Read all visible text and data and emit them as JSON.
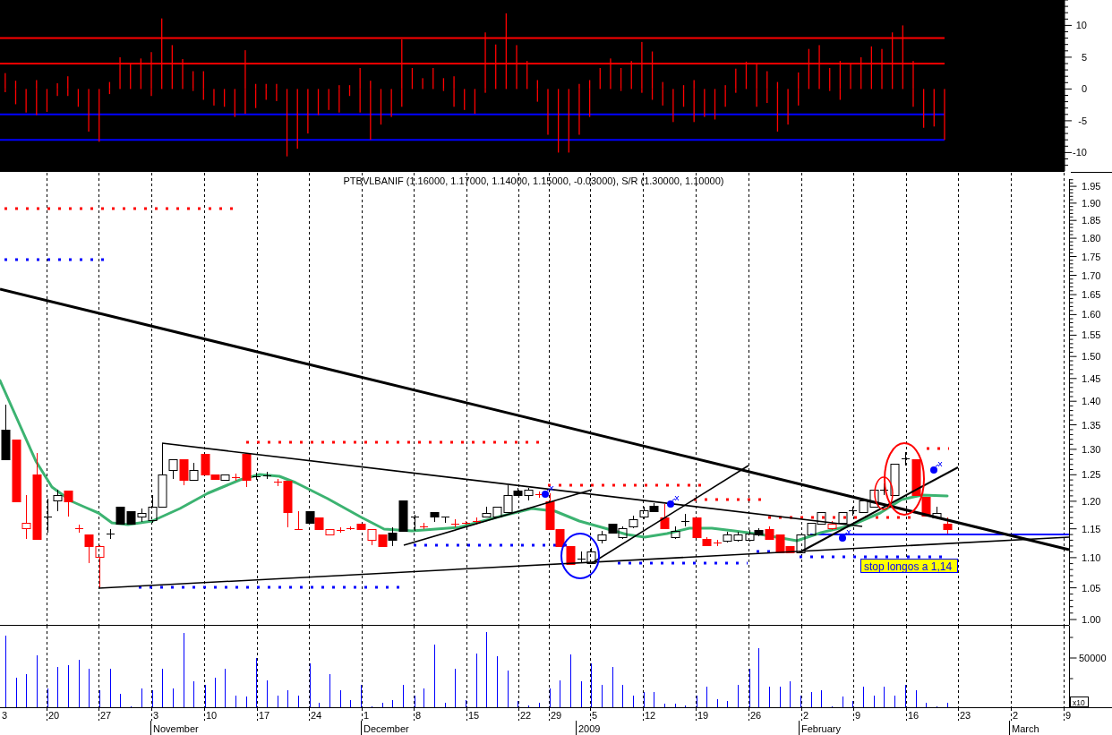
{
  "oscillator": {
    "chart_data": {
      "type": "bar",
      "stacked": true,
      "categories": [
        null,
        null,
        null,
        null,
        null,
        null,
        null,
        null,
        null,
        null,
        null,
        null,
        null,
        null,
        null,
        null,
        null,
        null,
        null,
        null,
        null,
        null,
        null,
        null,
        null,
        null,
        null,
        null,
        null,
        null,
        null,
        null,
        null,
        null,
        null,
        null,
        null,
        null,
        null,
        null,
        null,
        null,
        null,
        null,
        null,
        null,
        null,
        null,
        null,
        null,
        null,
        null,
        null,
        null,
        null,
        null,
        null,
        null,
        null,
        null,
        null,
        null,
        null,
        null,
        null,
        null,
        null,
        null,
        null,
        null,
        null,
        null,
        null,
        null,
        null,
        null,
        null,
        null,
        null,
        null,
        null,
        null,
        null,
        null,
        null,
        null,
        null,
        null,
        null,
        null,
        null,
        null,
        null,
        null,
        null,
        null,
        null,
        null,
        null,
        null,
        null,
        null
      ],
      "ylim": [
        -12.9,
        14
      ],
      "yticks": [
        -10,
        -5,
        0,
        5,
        10
      ],
      "series": [
        {
          "color": "#ff0000",
          "values": [
            2.5,
            1.3,
            0,
            1.4,
            0,
            0.9,
            2,
            0,
            0,
            0,
            1.1,
            5,
            4.1,
            4.8,
            5.8,
            11.1,
            6.9,
            4.7,
            2.8,
            2.8,
            0,
            0,
            0,
            6.1,
            0.8,
            0.8,
            0.8,
            0,
            0,
            0,
            0,
            0,
            0.6,
            0.6,
            3.3,
            1.3,
            0,
            0,
            7.8,
            3.3,
            1.7,
            3.3,
            1.7,
            2,
            0,
            0,
            8.9,
            7,
            11.9,
            6.9,
            4.4,
            1.4,
            0,
            0,
            0,
            0.8,
            1.4,
            3.3,
            4.8,
            3.3,
            4.4,
            7.4,
            5.9,
            1.1,
            0,
            0.6,
            1.4,
            0,
            0,
            0.6,
            3.2,
            4.3,
            4.1,
            2.8,
            1.1,
            0,
            2.6,
            6.3,
            6.9,
            3.3,
            4.4,
            4.1,
            5,
            6.7,
            6.3,
            8.9,
            10,
            4.4,
            0,
            0,
            0,
            null,
            null,
            null,
            null,
            null,
            null,
            null,
            null,
            null,
            null,
            null
          ]
        },
        {
          "color": "#ff0000",
          "values": [
            -0.5,
            -2.4,
            -3.7,
            -4.1,
            -3.6,
            -1.1,
            -1.1,
            -2.8,
            -6.7,
            -8.3,
            -0.8,
            0,
            0,
            0,
            -1.1,
            0,
            0,
            0,
            -0.3,
            -1.7,
            -2.6,
            -2.8,
            -4.4,
            -3.9,
            -3,
            -1.7,
            -1.9,
            -10.6,
            -9.4,
            -7,
            -4.1,
            -3.3,
            -3.7,
            -1.1,
            -3.7,
            -8,
            -5.6,
            -4.4,
            -2.8,
            0,
            0,
            0,
            -0.3,
            -2.8,
            -3.3,
            -3.9,
            -0.6,
            0,
            0,
            0,
            0,
            -2,
            -7.2,
            -10,
            -10,
            -7.2,
            -4.4,
            0,
            0,
            -0.3,
            0,
            -0.6,
            -1.7,
            -2.6,
            -5.2,
            -2.8,
            -5.2,
            -4.4,
            -4.8,
            -2.8,
            -0.6,
            0,
            -2.8,
            -2.2,
            -6.7,
            -5.6,
            -2.6,
            0,
            0,
            -0.3,
            -1.7,
            0,
            0,
            0,
            0,
            0,
            0,
            -2.8,
            -6.1,
            -5.9,
            -8,
            null,
            null,
            null,
            null,
            null,
            null,
            null,
            null,
            null,
            null,
            null
          ]
        }
      ],
      "ref_lines": [
        {
          "axis": "y",
          "value": 8,
          "color": "#ff0000"
        },
        {
          "axis": "y",
          "value": 4,
          "color": "#ff0000"
        },
        {
          "axis": "y",
          "value": -4,
          "color": "#0000ff"
        },
        {
          "axis": "y",
          "value": -8,
          "color": "#0000ff"
        }
      ]
    }
  },
  "price_chart": {
    "title": "PTBVLBANIF (1.16000, 1.17000, 1.14000, 1.15000, -0.03000), S/R (1.30000, 1.10000)",
    "note": "stop longos a 1,14",
    "axis_labels": [
      "1.95",
      "1.90",
      "1.85",
      "1.80",
      "1.75",
      "1.70",
      "1.65",
      "1.60",
      "1.55",
      "1.50",
      "1.45",
      "1.40",
      "1.35",
      "1.30",
      "1.25",
      "1.20",
      "1.15",
      "1.10",
      "1.05",
      "1.00"
    ]
  },
  "volume_chart": {
    "axis_label": "50000",
    "multiplier": "x10"
  },
  "date_axis": {
    "days": [
      "3",
      "20",
      "27",
      "3",
      "10",
      "17",
      "24",
      "1",
      "8",
      "15",
      "22",
      "29",
      "5",
      "12",
      "19",
      "26",
      "2",
      "9",
      "16",
      "23",
      "2",
      "9"
    ],
    "months": [
      "November",
      "December",
      "2009",
      "February",
      "March"
    ]
  }
}
